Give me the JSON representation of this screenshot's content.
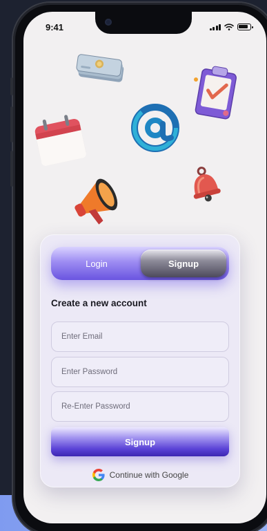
{
  "status_bar": {
    "time": "9:41"
  },
  "auth": {
    "tabs": [
      {
        "label": "Login"
      },
      {
        "label": "Signup"
      }
    ],
    "active_tab": "Signup",
    "heading": "Create a new account",
    "email": {
      "value": "",
      "placeholder": "Enter Email"
    },
    "password": {
      "value": "",
      "placeholder": "Enter Password"
    },
    "confirm_password": {
      "value": "",
      "placeholder": "Re-Enter Password"
    },
    "submit_label": "Signup",
    "google_label": "Continue with Google"
  },
  "decor_icons": [
    "money-stack-icon",
    "clipboard-check-icon",
    "calendar-icon",
    "at-sign-icon",
    "bell-icon",
    "megaphone-icon"
  ],
  "colors": {
    "accent": "#6a55e0",
    "screen_bg": "#f2f0f1",
    "card_bg": "#ece9f6",
    "backdrop": "#1d2230"
  }
}
